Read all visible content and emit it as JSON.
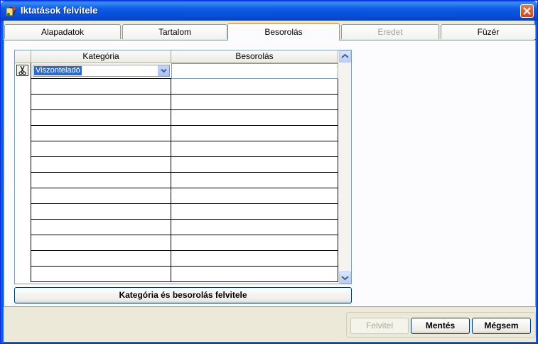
{
  "window": {
    "title": "Iktatások felvitele"
  },
  "tabs": [
    {
      "label": "Alapadatok"
    },
    {
      "label": "Tartalom"
    },
    {
      "label": "Besorolás"
    },
    {
      "label": "Eredet"
    },
    {
      "label": "Füzér"
    }
  ],
  "grid": {
    "columns": [
      "Kategória",
      "Besorolás"
    ],
    "rows": [
      {
        "kategoria": "Viszonteladó",
        "besorolas": ""
      },
      {
        "kategoria": "",
        "besorolas": ""
      },
      {
        "kategoria": "",
        "besorolas": ""
      },
      {
        "kategoria": "",
        "besorolas": ""
      },
      {
        "kategoria": "",
        "besorolas": ""
      },
      {
        "kategoria": "",
        "besorolas": ""
      },
      {
        "kategoria": "",
        "besorolas": ""
      },
      {
        "kategoria": "",
        "besorolas": ""
      },
      {
        "kategoria": "",
        "besorolas": ""
      },
      {
        "kategoria": "",
        "besorolas": ""
      },
      {
        "kategoria": "",
        "besorolas": ""
      },
      {
        "kategoria": "",
        "besorolas": ""
      },
      {
        "kategoria": "",
        "besorolas": ""
      },
      {
        "kategoria": "",
        "besorolas": ""
      }
    ]
  },
  "actions": {
    "add_category_label": "Kategória és besorolás felvitele",
    "felvitel_label": "Felvitel",
    "mentes_label": "Mentés",
    "megsem_label": "Mégsem"
  },
  "icons": {
    "app": "app-icon",
    "close": "close-icon",
    "row_delete": "scissors-icon",
    "dropdown": "chevron-down-icon",
    "scroll_up": "scroll-up-icon",
    "scroll_down": "scroll-down-icon"
  },
  "colors": {
    "titlebar": "#0a5ae6",
    "selection": "#316ac5",
    "active_tab_accent": "#f7a843"
  }
}
